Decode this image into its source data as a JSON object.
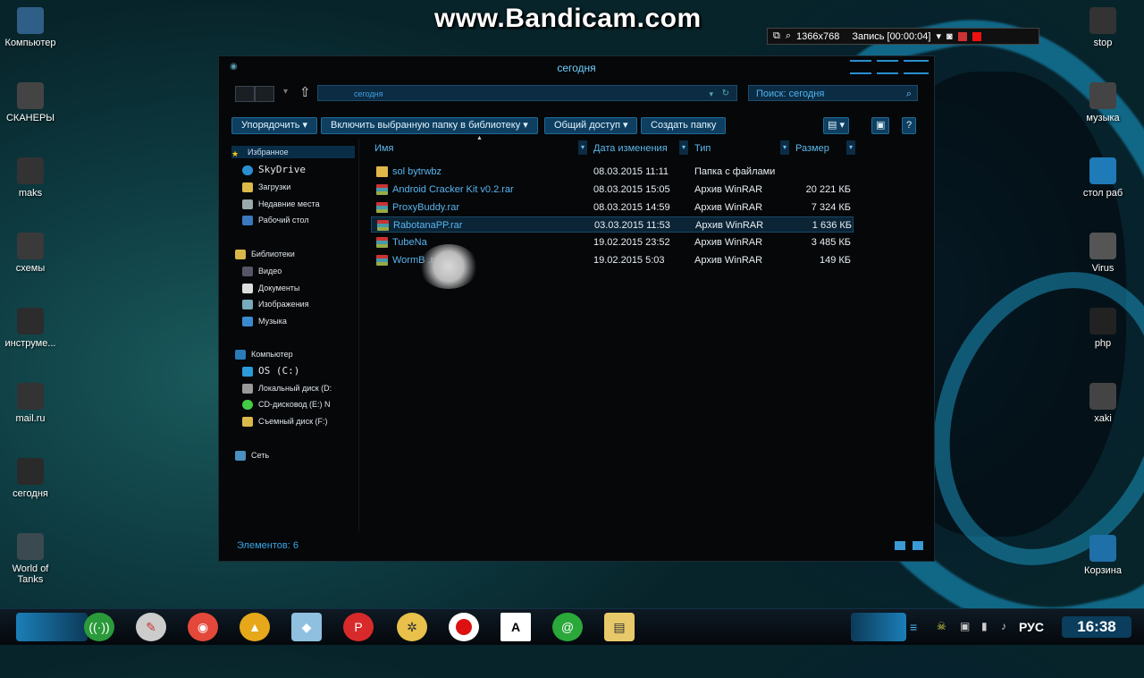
{
  "watermark": "www.Bandicam.com",
  "recorder": {
    "resolution": "1366x768",
    "status": "Запись [00:00:04]"
  },
  "desktop_left": [
    {
      "label": "Компьютер",
      "icon": "computer-icon"
    },
    {
      "label": "СКАНЕРЫ",
      "icon": "scanner-icon"
    },
    {
      "label": "maks",
      "icon": "exe-icon"
    },
    {
      "label": "схемы",
      "icon": "schematic-icon"
    },
    {
      "label": "инструме...",
      "icon": "tools-icon"
    },
    {
      "label": "mail.ru",
      "icon": "mail-icon"
    },
    {
      "label": "сегодня",
      "icon": "video-icon"
    },
    {
      "label": "World of\nTanks",
      "icon": "tanks-icon"
    }
  ],
  "desktop_right": [
    {
      "label": "stop",
      "icon": "stop-icon"
    },
    {
      "label": "музыка",
      "icon": "music-icon"
    },
    {
      "label": "стол раб",
      "icon": "desk-icon"
    },
    {
      "label": "Virus",
      "icon": "virus-icon"
    },
    {
      "label": "php",
      "icon": "php-icon"
    },
    {
      "label": "xaki",
      "icon": "xaki-icon"
    },
    {
      "label": "Корзина",
      "icon": "recycle-bin-icon"
    }
  ],
  "window": {
    "title": "сегодня",
    "address": "сегодня",
    "search_placeholder": "Поиск: сегодня",
    "toolbar": {
      "organize": "Упорядочить",
      "include": "Включить выбранную папку в библиотеку",
      "share": "Общий доступ",
      "new_folder": "Создать папку"
    },
    "sidebar": {
      "favorites": "Избранное",
      "skydrive": "SkyDrive",
      "downloads": "Загрузки",
      "recent": "Недавние места",
      "desktop": "Рабочий стол",
      "libraries": "Библиотеки",
      "video": "Видео",
      "documents": "Документы",
      "images": "Изображения",
      "music": "Музыка",
      "computer": "Компьютер",
      "os": "OS (C:)",
      "local": "Локальный диск (D:",
      "cd": "CD-дисковод (E:) N",
      "removable": "Съемный диск (F:)",
      "network": "Сеть"
    },
    "columns": {
      "name": "Имя",
      "date": "Дата изменения",
      "type": "Тип",
      "size": "Размер"
    },
    "files": [
      {
        "name": "sol bytrwbz",
        "date": "08.03.2015 11:11",
        "type": "Папка с файлами",
        "size": "",
        "kind": "folder"
      },
      {
        "name": "Android Cracker Kit v0.2.rar",
        "date": "08.03.2015 15:05",
        "type": "Архив WinRAR",
        "size": "20 221 КБ",
        "kind": "rar"
      },
      {
        "name": "ProxyBuddy.rar",
        "date": "08.03.2015 14:59",
        "type": "Архив WinRAR",
        "size": "7 324 КБ",
        "kind": "rar"
      },
      {
        "name": "RabotanaPP.rar",
        "date": "03.03.2015 11:53",
        "type": "Архив WinRAR",
        "size": "1 636 КБ",
        "kind": "rar"
      },
      {
        "name": "TubeNa",
        "date": "19.02.2015 23:52",
        "type": "Архив WinRAR",
        "size": "3 485 КБ",
        "kind": "rar"
      },
      {
        "name": "WormB                .rar",
        "date": "19.02.2015 5:03",
        "type": "Архив WinRAR",
        "size": "149 КБ",
        "kind": "rar"
      }
    ],
    "selected_index": 3,
    "status": "Элементов: 6"
  },
  "taskbar": {
    "lang": "РУС",
    "clock": "16:38"
  },
  "colors": {
    "accent": "#2a8fd0",
    "link": "#5ab5ef",
    "window_bg": "#050709"
  }
}
